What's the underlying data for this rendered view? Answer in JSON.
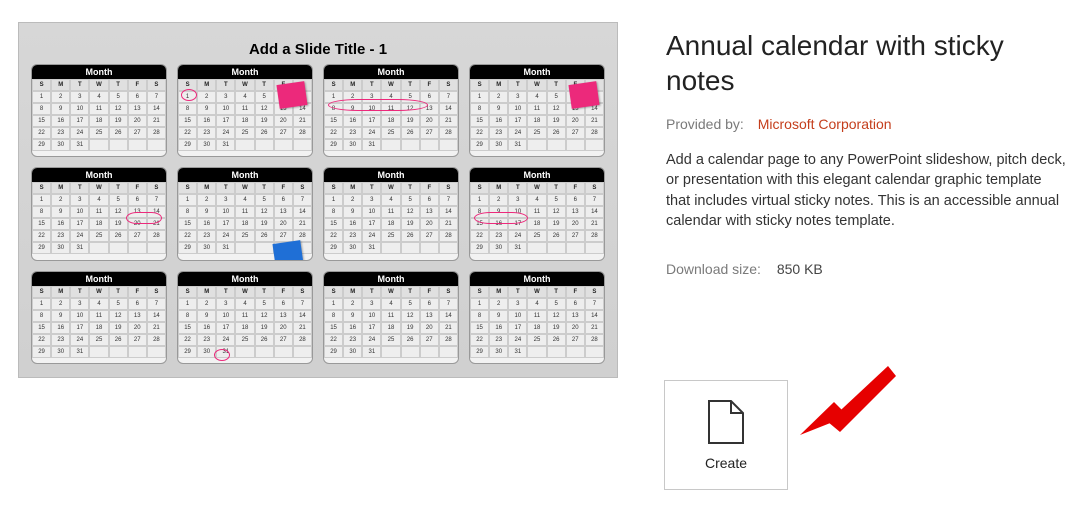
{
  "preview": {
    "slide_title": "Add a Slide Title - 1",
    "month_label": "Month",
    "dow": [
      "S",
      "M",
      "T",
      "W",
      "T",
      "F",
      "S"
    ],
    "weeks": [
      [
        "1",
        "2",
        "3",
        "4",
        "5",
        "6",
        "7"
      ],
      [
        "8",
        "9",
        "10",
        "11",
        "12",
        "13",
        "14"
      ],
      [
        "15",
        "16",
        "17",
        "18",
        "19",
        "20",
        "21"
      ],
      [
        "22",
        "23",
        "24",
        "25",
        "26",
        "27",
        "28"
      ],
      [
        "29",
        "30",
        "31",
        "",
        "",
        "",
        ""
      ]
    ],
    "sticky_colors": {
      "pink": "#ec297b",
      "blue": "#1f6fd6"
    },
    "annotations": {
      "month1_circle_day": "1",
      "month3_oval_days": "8-12",
      "month5_oval_days": "20-21",
      "month8_oval_days": "15-17",
      "month10_circle_day": "31"
    }
  },
  "info": {
    "title": "Annual calendar with sticky notes",
    "provided_label": "Provided by:",
    "provider": "Microsoft Corporation",
    "description": "Add a calendar page to any PowerPoint slideshow, pitch deck, or presentation with this elegant calendar graphic template that includes virtual sticky notes. This is an accessible annual calendar with sticky notes template.",
    "download_label": "Download size:",
    "download_value": "850 KB"
  },
  "actions": {
    "create_label": "Create"
  }
}
